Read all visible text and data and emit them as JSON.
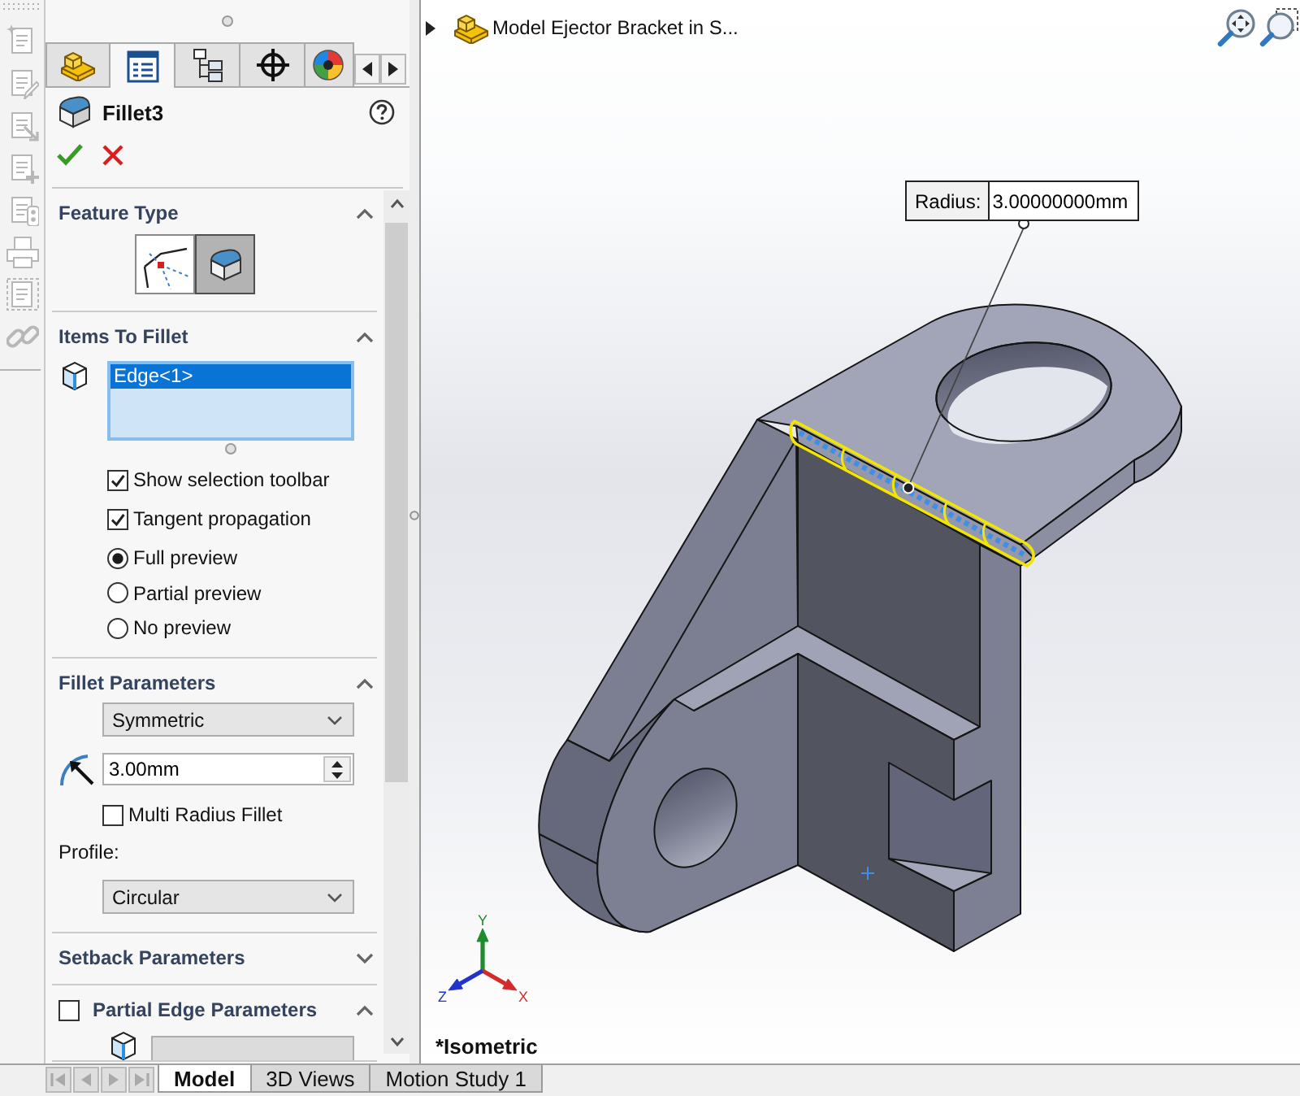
{
  "left_toolbar": {
    "tools": [
      {
        "kind": "new",
        "disabled": true
      },
      {
        "kind": "edit",
        "disabled": true
      },
      {
        "kind": "move",
        "disabled": true
      },
      {
        "kind": "add",
        "disabled": true
      },
      {
        "kind": "stack",
        "disabled": true
      },
      {
        "kind": "print",
        "disabled": true
      },
      {
        "kind": "frame",
        "disabled": true
      },
      {
        "kind": "link",
        "disabled": true
      }
    ]
  },
  "property_manager": {
    "tabs": [
      {
        "kind": "feature_tree",
        "selected": false
      },
      {
        "kind": "properties",
        "selected": true
      },
      {
        "kind": "configurations",
        "selected": false
      },
      {
        "kind": "dimxpert",
        "selected": false
      },
      {
        "kind": "appearance",
        "selected": false
      }
    ],
    "title": "Fillet3",
    "sections": [
      {
        "kind": "feature_type",
        "title": "Feature Type",
        "expanded": true,
        "options": [
          {
            "kind": "corner",
            "selected": false
          },
          {
            "kind": "edge",
            "selected": true
          }
        ]
      },
      {
        "kind": "items",
        "title": "Items To Fillet",
        "expanded": true,
        "selection": [
          {
            "label": "Edge<1>",
            "selected": true
          }
        ],
        "options": [
          {
            "kind": "checkbox",
            "label": "Show selection toolbar",
            "checked": true
          },
          {
            "kind": "checkbox",
            "label": "Tangent propagation",
            "checked": true
          },
          {
            "kind": "radio",
            "label": "Full preview",
            "selected": true
          },
          {
            "kind": "radio",
            "label": "Partial preview",
            "selected": false
          },
          {
            "kind": "radio",
            "label": "No preview",
            "selected": false
          }
        ]
      },
      {
        "kind": "parameters",
        "title": "Fillet Parameters",
        "expanded": true,
        "method": "Symmetric",
        "radius": "3.00mm",
        "multi_radius": {
          "label": "Multi Radius Fillet",
          "checked": false
        },
        "profile_label": "Profile:",
        "profile": "Circular"
      },
      {
        "kind": "plain",
        "title": "Setback Parameters",
        "expanded": false
      },
      {
        "kind": "partial",
        "title": "Partial Edge Parameters",
        "expanded": true,
        "checked": false
      }
    ]
  },
  "viewport": {
    "breadcrumb": {
      "label": "Model Ejector Bracket in S...",
      "expanded": false
    },
    "callout": {
      "label": "Radius:",
      "value": "3.00000000mm"
    },
    "triad": [
      {
        "kind": "y",
        "label": "Y",
        "color": "#1f8a2e"
      },
      {
        "kind": "x",
        "label": "X",
        "color": "#d42a2a"
      },
      {
        "kind": "z",
        "label": "Z",
        "color": "#2233cc"
      }
    ],
    "view_name": "*Isometric"
  },
  "bottom_tabs": {
    "navigation": [
      {
        "kind": "first",
        "disabled": true
      },
      {
        "kind": "previous",
        "disabled": true
      },
      {
        "kind": "next",
        "disabled": true
      },
      {
        "kind": "last",
        "disabled": true
      }
    ],
    "tabs": [
      {
        "label": "Model",
        "selected": true
      },
      {
        "label": "3D Views",
        "selected": false
      },
      {
        "label": "Motion Study 1",
        "selected": false
      }
    ]
  }
}
